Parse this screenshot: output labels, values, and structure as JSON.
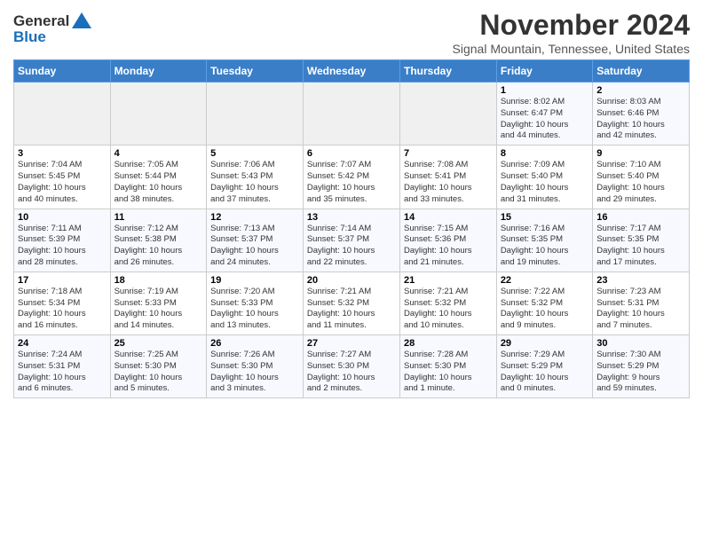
{
  "header": {
    "logo_general": "General",
    "logo_blue": "Blue",
    "month_title": "November 2024",
    "location": "Signal Mountain, Tennessee, United States"
  },
  "weekdays": [
    "Sunday",
    "Monday",
    "Tuesday",
    "Wednesday",
    "Thursday",
    "Friday",
    "Saturday"
  ],
  "weeks": [
    [
      {
        "day": "",
        "info": ""
      },
      {
        "day": "",
        "info": ""
      },
      {
        "day": "",
        "info": ""
      },
      {
        "day": "",
        "info": ""
      },
      {
        "day": "",
        "info": ""
      },
      {
        "day": "1",
        "info": "Sunrise: 8:02 AM\nSunset: 6:47 PM\nDaylight: 10 hours\nand 44 minutes."
      },
      {
        "day": "2",
        "info": "Sunrise: 8:03 AM\nSunset: 6:46 PM\nDaylight: 10 hours\nand 42 minutes."
      }
    ],
    [
      {
        "day": "3",
        "info": "Sunrise: 7:04 AM\nSunset: 5:45 PM\nDaylight: 10 hours\nand 40 minutes."
      },
      {
        "day": "4",
        "info": "Sunrise: 7:05 AM\nSunset: 5:44 PM\nDaylight: 10 hours\nand 38 minutes."
      },
      {
        "day": "5",
        "info": "Sunrise: 7:06 AM\nSunset: 5:43 PM\nDaylight: 10 hours\nand 37 minutes."
      },
      {
        "day": "6",
        "info": "Sunrise: 7:07 AM\nSunset: 5:42 PM\nDaylight: 10 hours\nand 35 minutes."
      },
      {
        "day": "7",
        "info": "Sunrise: 7:08 AM\nSunset: 5:41 PM\nDaylight: 10 hours\nand 33 minutes."
      },
      {
        "day": "8",
        "info": "Sunrise: 7:09 AM\nSunset: 5:40 PM\nDaylight: 10 hours\nand 31 minutes."
      },
      {
        "day": "9",
        "info": "Sunrise: 7:10 AM\nSunset: 5:40 PM\nDaylight: 10 hours\nand 29 minutes."
      }
    ],
    [
      {
        "day": "10",
        "info": "Sunrise: 7:11 AM\nSunset: 5:39 PM\nDaylight: 10 hours\nand 28 minutes."
      },
      {
        "day": "11",
        "info": "Sunrise: 7:12 AM\nSunset: 5:38 PM\nDaylight: 10 hours\nand 26 minutes."
      },
      {
        "day": "12",
        "info": "Sunrise: 7:13 AM\nSunset: 5:37 PM\nDaylight: 10 hours\nand 24 minutes."
      },
      {
        "day": "13",
        "info": "Sunrise: 7:14 AM\nSunset: 5:37 PM\nDaylight: 10 hours\nand 22 minutes."
      },
      {
        "day": "14",
        "info": "Sunrise: 7:15 AM\nSunset: 5:36 PM\nDaylight: 10 hours\nand 21 minutes."
      },
      {
        "day": "15",
        "info": "Sunrise: 7:16 AM\nSunset: 5:35 PM\nDaylight: 10 hours\nand 19 minutes."
      },
      {
        "day": "16",
        "info": "Sunrise: 7:17 AM\nSunset: 5:35 PM\nDaylight: 10 hours\nand 17 minutes."
      }
    ],
    [
      {
        "day": "17",
        "info": "Sunrise: 7:18 AM\nSunset: 5:34 PM\nDaylight: 10 hours\nand 16 minutes."
      },
      {
        "day": "18",
        "info": "Sunrise: 7:19 AM\nSunset: 5:33 PM\nDaylight: 10 hours\nand 14 minutes."
      },
      {
        "day": "19",
        "info": "Sunrise: 7:20 AM\nSunset: 5:33 PM\nDaylight: 10 hours\nand 13 minutes."
      },
      {
        "day": "20",
        "info": "Sunrise: 7:21 AM\nSunset: 5:32 PM\nDaylight: 10 hours\nand 11 minutes."
      },
      {
        "day": "21",
        "info": "Sunrise: 7:21 AM\nSunset: 5:32 PM\nDaylight: 10 hours\nand 10 minutes."
      },
      {
        "day": "22",
        "info": "Sunrise: 7:22 AM\nSunset: 5:32 PM\nDaylight: 10 hours\nand 9 minutes."
      },
      {
        "day": "23",
        "info": "Sunrise: 7:23 AM\nSunset: 5:31 PM\nDaylight: 10 hours\nand 7 minutes."
      }
    ],
    [
      {
        "day": "24",
        "info": "Sunrise: 7:24 AM\nSunset: 5:31 PM\nDaylight: 10 hours\nand 6 minutes."
      },
      {
        "day": "25",
        "info": "Sunrise: 7:25 AM\nSunset: 5:30 PM\nDaylight: 10 hours\nand 5 minutes."
      },
      {
        "day": "26",
        "info": "Sunrise: 7:26 AM\nSunset: 5:30 PM\nDaylight: 10 hours\nand 3 minutes."
      },
      {
        "day": "27",
        "info": "Sunrise: 7:27 AM\nSunset: 5:30 PM\nDaylight: 10 hours\nand 2 minutes."
      },
      {
        "day": "28",
        "info": "Sunrise: 7:28 AM\nSunset: 5:30 PM\nDaylight: 10 hours\nand 1 minute."
      },
      {
        "day": "29",
        "info": "Sunrise: 7:29 AM\nSunset: 5:29 PM\nDaylight: 10 hours\nand 0 minutes."
      },
      {
        "day": "30",
        "info": "Sunrise: 7:30 AM\nSunset: 5:29 PM\nDaylight: 9 hours\nand 59 minutes."
      }
    ]
  ]
}
